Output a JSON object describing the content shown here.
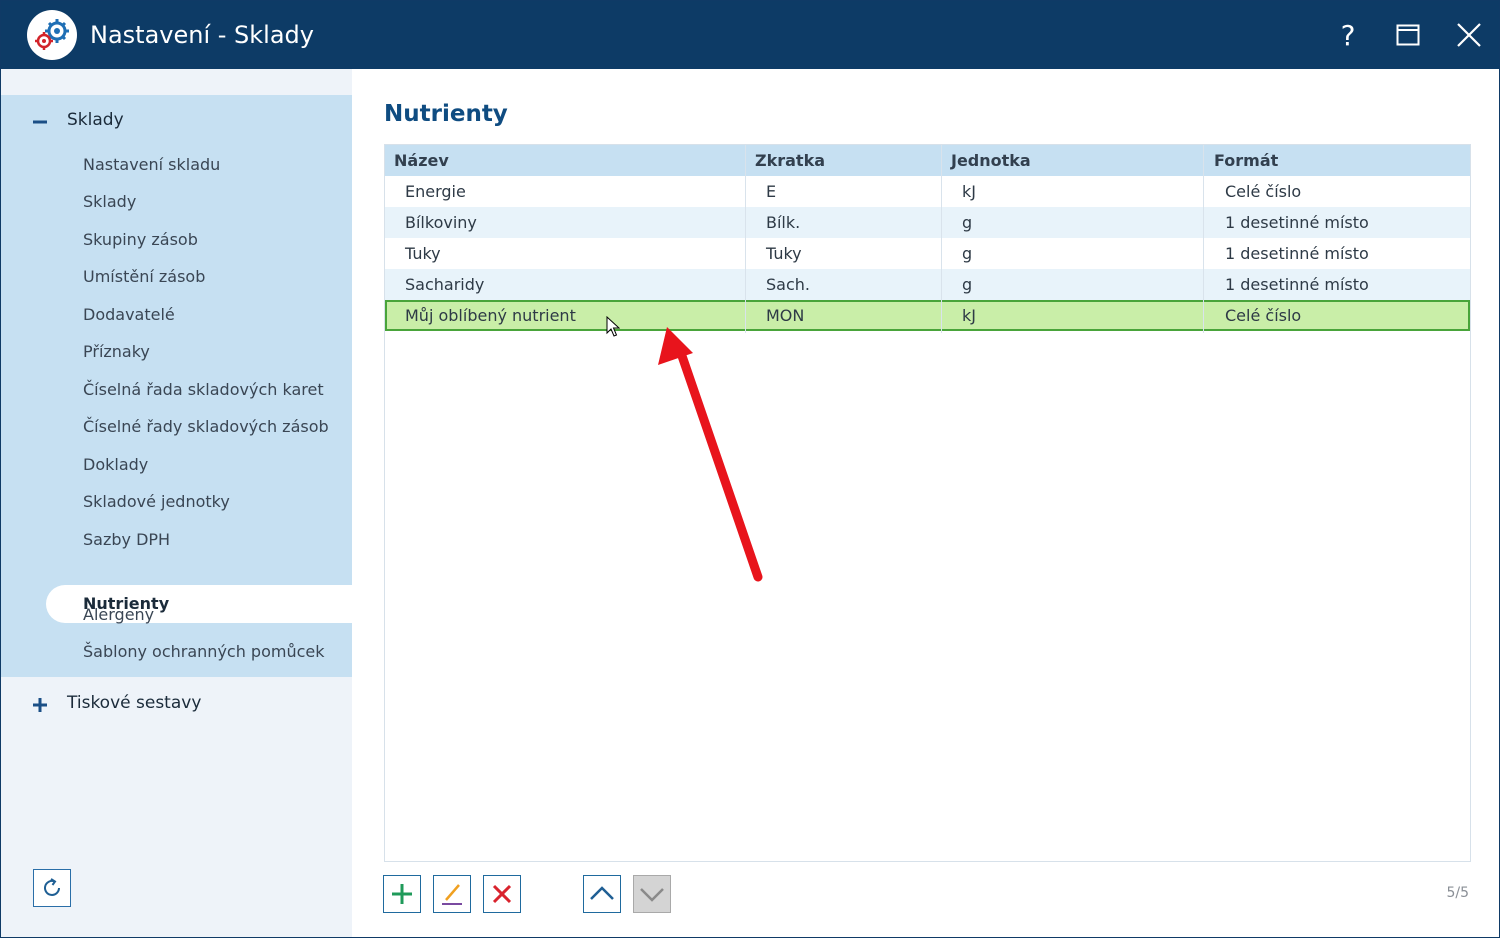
{
  "window": {
    "title": "Nastavení - Sklady"
  },
  "titlebar": {
    "help_label": "?",
    "icons": [
      "settings-gears-icon",
      "help-icon",
      "maximize-icon",
      "close-icon"
    ]
  },
  "sidebar": {
    "group1": {
      "label": "Sklady",
      "expanded": true,
      "items": [
        "Nastavení skladu",
        "Sklady",
        "Skupiny zásob",
        "Umístění zásob",
        "Dodavatelé",
        "Příznaky",
        "Číselná řada skladových karet",
        "Číselné řady skladových zásob",
        "Doklady",
        "Skladové jednotky",
        "Sazby DPH",
        "Nutrienty",
        "Alergeny",
        "Šablony ochranných pomůcek"
      ],
      "active_item": "Nutrienty"
    },
    "group2": {
      "label": "Tiskové sestavy",
      "expanded": false
    }
  },
  "main": {
    "title": "Nutrienty",
    "columns": [
      "Název",
      "Zkratka",
      "Jednotka",
      "Formát"
    ],
    "rows": [
      {
        "nazev": "Energie",
        "zkratka": "E",
        "jednotka": "kJ",
        "format": "Celé číslo"
      },
      {
        "nazev": "Bílkoviny",
        "zkratka": "Bílk.",
        "jednotka": "g",
        "format": "1 desetinné místo"
      },
      {
        "nazev": "Tuky",
        "zkratka": "Tuky",
        "jednotka": "g",
        "format": "1 desetinné místo"
      },
      {
        "nazev": "Sacharidy",
        "zkratka": "Sach.",
        "jednotka": "g",
        "format": "1 desetinné místo"
      },
      {
        "nazev": "Můj oblíbený nutrient",
        "zkratka": "MON",
        "jednotka": "kJ",
        "format": "Celé číslo"
      }
    ],
    "selected_row": 4,
    "counter": "5/5"
  },
  "toolbar": {
    "buttons": [
      "add-icon",
      "edit-pencil-icon",
      "delete-x-icon",
      "move-up-icon",
      "move-down-icon"
    ]
  },
  "colors": {
    "titlebar": "#0d3b66",
    "accent": "#0f4c81",
    "sidebar_group": "#c6e0f2",
    "selected_row": "#c9eea8",
    "selected_border": "#49a43a",
    "annotation_arrow": "#e8141c"
  }
}
